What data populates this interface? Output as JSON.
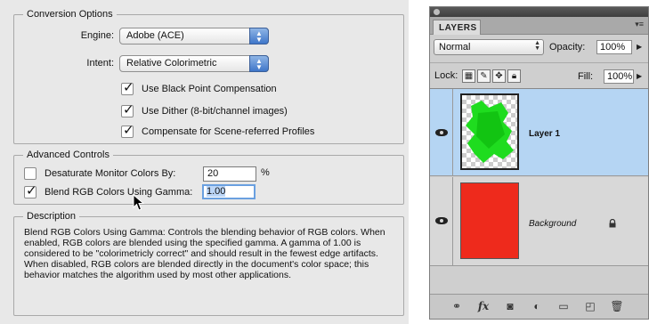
{
  "dialog": {
    "conversion": {
      "legend": "Conversion Options",
      "engine_label": "Engine:",
      "engine_value": "Adobe (ACE)",
      "intent_label": "Intent:",
      "intent_value": "Relative Colorimetric",
      "black_point": {
        "label": "Use Black Point Compensation",
        "checked": true
      },
      "dither": {
        "label": "Use Dither (8-bit/channel images)",
        "checked": true
      },
      "scene_referred": {
        "label": "Compensate for Scene-referred Profiles",
        "checked": true
      }
    },
    "advanced": {
      "legend": "Advanced Controls",
      "desaturate": {
        "label": "Desaturate Monitor Colors By:",
        "checked": false,
        "value": "20",
        "unit": "%"
      },
      "blend_gamma": {
        "label": "Blend RGB Colors Using Gamma:",
        "checked": true,
        "value": "1.00"
      }
    },
    "description": {
      "legend": "Description",
      "text": "Blend RGB Colors Using Gamma:  Controls the blending behavior of RGB colors. When enabled, RGB colors are blended using the specified gamma.  A gamma of 1.00 is considered to be \"colorimetricly correct\" and should result in the fewest edge artifacts.  When disabled, RGB colors are blended directly in the document's color space; this behavior matches the algorithm used by most other applications."
    }
  },
  "layers_panel": {
    "tab": "LAYERS",
    "blend_mode": "Normal",
    "opacity_label": "Opacity:",
    "opacity_value": "100%",
    "lock_label": "Lock:",
    "fill_label": "Fill:",
    "fill_value": "100%",
    "layers": [
      {
        "name": "Layer 1",
        "selected": true,
        "visible": true,
        "thumb_color": "#20e020"
      },
      {
        "name": "Background",
        "selected": false,
        "visible": true,
        "locked": true,
        "thumb_color": "#ee2a1c"
      }
    ],
    "bottom_icons": [
      "link-icon",
      "fx-icon",
      "mask-icon",
      "adjustment-icon",
      "folder-icon",
      "new-layer-icon",
      "trash-icon"
    ],
    "fx_label": "fx"
  },
  "colors": {
    "selection": "#b5d5f3",
    "accent": "#3f76c9"
  }
}
